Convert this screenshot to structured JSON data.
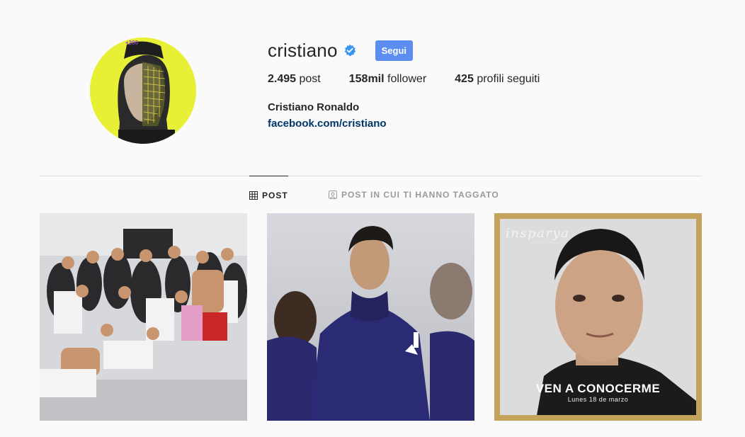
{
  "profile": {
    "username": "cristiano",
    "follow_label": "Segui",
    "name": "Cristiano Ronaldo",
    "link": "facebook.com/cristiano",
    "avatar_badge": "+200"
  },
  "stats": {
    "posts_value": "2.495",
    "posts_label": "post",
    "followers_value": "158mil",
    "followers_label": "follower",
    "following_value": "425",
    "following_label": "profili seguiti"
  },
  "tabs": {
    "posts": "POST",
    "tagged": "POST IN CUI TI HANNO TAGGATO"
  },
  "grid": {
    "promo_brand": "insparya",
    "promo_brand_sub": "HAIR COMPANY",
    "promo_title": "VEN A CONOCERME",
    "promo_subtitle": "Lunes 18 de marzo"
  },
  "colors": {
    "accent": "#5b8ef0",
    "verified": "#3897f0",
    "link": "#003569",
    "background": "#fafafa"
  },
  "icons": {
    "verified": "verified-badge-icon",
    "posts_tab": "grid-icon",
    "tagged_tab": "tagged-person-icon"
  }
}
